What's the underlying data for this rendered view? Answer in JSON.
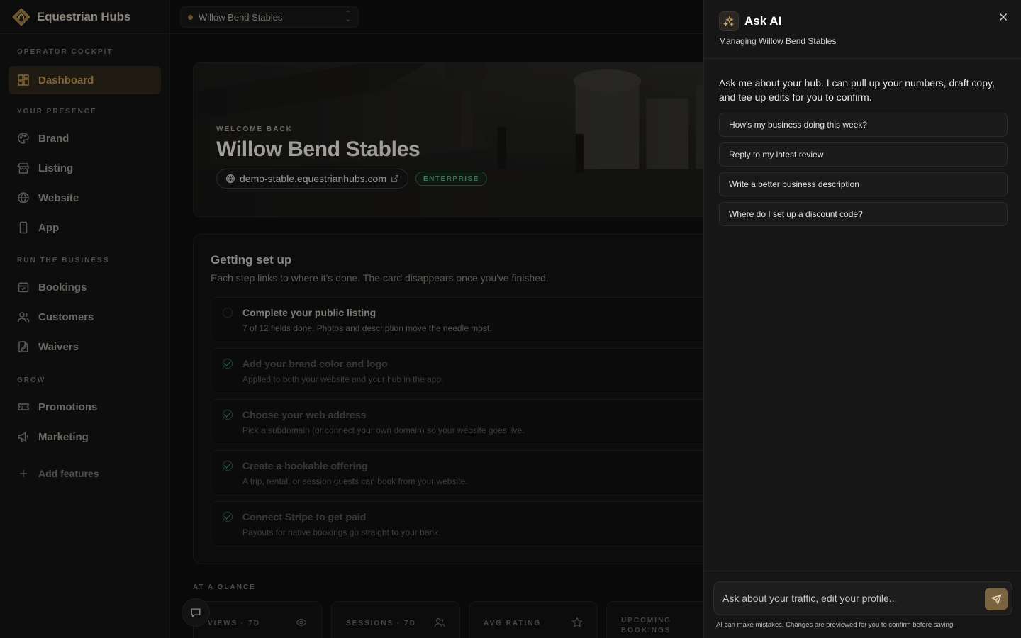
{
  "brand": {
    "name": "Equestrian Hubs"
  },
  "topbar": {
    "stable": "Willow Bend Stables"
  },
  "sidebar": {
    "sections": [
      {
        "heading": "OPERATOR COCKPIT",
        "items": [
          {
            "label": "Dashboard",
            "icon": "dashboard-icon",
            "active": true
          }
        ]
      },
      {
        "heading": "YOUR PRESENCE",
        "items": [
          {
            "label": "Brand",
            "icon": "palette-icon"
          },
          {
            "label": "Listing",
            "icon": "store-icon"
          },
          {
            "label": "Website",
            "icon": "globe-icon"
          },
          {
            "label": "App",
            "icon": "phone-icon"
          }
        ]
      },
      {
        "heading": "RUN THE BUSINESS",
        "items": [
          {
            "label": "Bookings",
            "icon": "calendar-icon"
          },
          {
            "label": "Customers",
            "icon": "users-icon"
          },
          {
            "label": "Waivers",
            "icon": "document-sign-icon"
          }
        ]
      },
      {
        "heading": "GROW",
        "items": [
          {
            "label": "Promotions",
            "icon": "ticket-icon"
          },
          {
            "label": "Marketing",
            "icon": "megaphone-icon"
          }
        ]
      }
    ],
    "add_features": "Add features"
  },
  "hero": {
    "eyebrow": "WELCOME BACK",
    "title": "Willow Bend Stables",
    "domain": "demo-stable.equestrianhubs.com",
    "plan": "ENTERPRISE"
  },
  "setup": {
    "title": "Getting set up",
    "subtitle": "Each step links to where it's done. The card disappears once you've finished.",
    "steps": [
      {
        "title": "Complete your public listing",
        "desc": "7 of 12 fields done. Photos and description move the needle most.",
        "done": false
      },
      {
        "title": "Add your brand color and logo",
        "desc": "Applied to both your website and your hub in the app.",
        "done": true
      },
      {
        "title": "Choose your web address",
        "desc": "Pick a subdomain (or connect your own domain) so your website goes live.",
        "done": true
      },
      {
        "title": "Create a bookable offering",
        "desc": "A trip, rental, or session guests can book from your website.",
        "done": true
      },
      {
        "title": "Connect Stripe to get paid",
        "desc": "Payouts for native bookings go straight to your bank.",
        "done": true
      }
    ]
  },
  "glance": {
    "label": "AT A GLANCE",
    "stats": [
      {
        "label": "VIEWS · 7D",
        "icon": "eye-icon"
      },
      {
        "label": "SESSIONS · 7D",
        "icon": "users-icon"
      },
      {
        "label": "AVG RATING",
        "icon": "star-icon"
      },
      {
        "label": "UPCOMING BOOKINGS",
        "icon": ""
      }
    ]
  },
  "ai": {
    "title": "Ask AI",
    "subtitle": "Managing Willow Bend Stables",
    "intro": "Ask me about your hub. I can pull up your numbers, draft copy, and tee up edits for you to confirm.",
    "suggestions": [
      "How's my business doing this week?",
      "Reply to my latest review",
      "Write a better business description",
      "Where do I set up a discount code?"
    ],
    "input_placeholder": "Ask about your traffic, edit your profile...",
    "disclaimer": "AI can make mistakes. Changes are previewed for you to confirm before saving."
  },
  "colors": {
    "accent": "#b08a4c",
    "success": "#4f9a6c",
    "background": "#0c0c0c",
    "panel": "#161616"
  }
}
